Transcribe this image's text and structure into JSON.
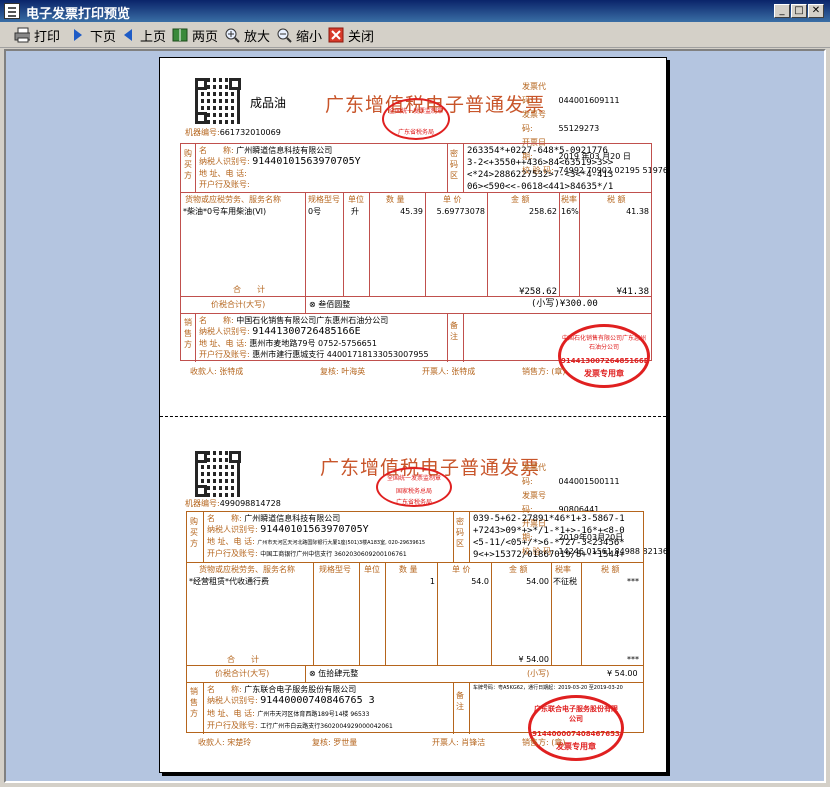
{
  "window": {
    "title": "电子发票打印预览"
  },
  "toolbar": [
    {
      "label": "打印",
      "icon": "printer-icon"
    },
    {
      "label": "下页",
      "icon": "next-page-icon"
    },
    {
      "label": "上页",
      "icon": "prev-page-icon"
    },
    {
      "label": "两页",
      "icon": "two-page-icon"
    },
    {
      "label": "放大",
      "icon": "zoom-in-icon"
    },
    {
      "label": "缩小",
      "icon": "zoom-out-icon"
    },
    {
      "label": "关闭",
      "icon": "close-icon"
    }
  ],
  "invoice1": {
    "product_tag": "成品油",
    "title": "广东增值税电子普通发票",
    "stamp_top": "全国统一发票监制章",
    "stamp_top_sub": "广东省税务局",
    "code_label": "发票代码:",
    "code": "044001609111",
    "number_label": "发票号码:",
    "number": "55129273",
    "date_label": "开票日期:",
    "date": "2019 年03 月20 日",
    "check_label": "校 验 码:",
    "check": "74992 70902 02195 51976",
    "machine_label": "机器编号:",
    "machine": "661732010069",
    "buyer_side": "购买方",
    "buyer_name_label": "名　　称:",
    "buyer_name": "广州瞬道信息科技有限公司",
    "buyer_tax_label": "纳税人识别号:",
    "buyer_tax": "91440101563970705Y",
    "buyer_addr_label": "地 址、电 话:",
    "buyer_bank_label": "开户行及账号:",
    "cipher_side": "密码区",
    "cipher": [
      "263354*+0227-648*5-0921776",
      "3-2<+3550++436>84<63519>3>>",
      "<*24>2886227532>7-<3<*4-413",
      "06><590<<-0618<441>84635*/1"
    ],
    "col_item": "货物或应税劳务、服务名称",
    "col_spec": "规格型号",
    "col_unit": "单位",
    "col_qty": "数 量",
    "col_price": "单 价",
    "col_amount": "金 额",
    "col_rate": "税率",
    "col_tax": "税 额",
    "item": "*柴油*0号车用柴油(VI)",
    "spec": "0号",
    "unit": "升",
    "qty": "45.39",
    "price": "5.69773078",
    "amount": "258.62",
    "rate": "16%",
    "tax": "41.38",
    "subtotal_label": "合　　计",
    "subtotal_amount": "¥258.62",
    "subtotal_tax": "¥41.38",
    "total_label": "价税合计(大写)",
    "total_words": "⊗ 叁佰圆整",
    "total_small": "(小写)¥300.00",
    "seller_side": "销售方",
    "seller_name_label": "名　　称:",
    "seller_name": "中国石化销售有限公司广东惠州石油分公司",
    "seller_tax_label": "纳税人识别号:",
    "seller_tax": "91441300726485166E",
    "seller_addr_label": "地 址、电 话:",
    "seller_addr": "惠州市麦地路79号 0752-5756651",
    "seller_bank_label": "开户行及账号:",
    "seller_bank": "惠州市建行惠城支行 44001718133053007955",
    "remark_side": "备注",
    "seller_stamp_top": "中国石化销售有限公司广东惠州石油分公司",
    "seller_stamp_id": "91441300726485166E",
    "seller_stamp_bottom": "发票专用章",
    "payee": "收款人: 张特成",
    "reviewer": "复核: 叶海英",
    "drawer": "开票人: 张特成",
    "seller_sign": "销售方: (章)"
  },
  "invoice2": {
    "title": "广东增值税电子普通发票",
    "stamp_top": "全国统一发票监制章",
    "stamp_top_sub": "国家税务总局",
    "stamp_top_sub2": "广东省税务局",
    "code_label": "发票代码:",
    "code": "044001500111",
    "number_label": "发票号码:",
    "number": "90806441",
    "date_label": "开票日期:",
    "date": "2019年03月20日",
    "check_label": "校 验 码:",
    "check": "14246 01561 84988 82136",
    "machine_label": "机器编号:",
    "machine": "499098814728",
    "buyer_side": "购买方",
    "buyer_name_label": "名　　称:",
    "buyer_name": "广州瞬道信息科技有限公司",
    "buyer_tax_label": "纳税人识别号:",
    "buyer_tax": "91440101563970705Y",
    "buyer_addr_label": "地 址、电 话:",
    "buyer_addr": "广州市天河区天河北路国际银行大厦1座(501)3楼A183室, 020-29639615",
    "buyer_bank_label": "开户行及账号:",
    "buyer_bank": "中国工商银行广州中信支行 3602030609200106761",
    "cipher_side": "密码区",
    "cipher": [
      "039-5+62-27891*46*1+3-5867-1",
      "+7243>09*+>*/1-*1+>-16*+<8-0",
      "<5-11/<05+/*>6-*727-3<23456*",
      "9<+>15372/01867019/8+-*1544+"
    ],
    "col_item": "货物或应税劳务、服务名称",
    "col_spec": "规格型号",
    "col_unit": "单位",
    "col_qty": "数 量",
    "col_price": "单 价",
    "col_amount": "金 额",
    "col_rate": "税率",
    "col_tax": "税 额",
    "item": "*经营租赁*代收通行费",
    "qty": "1",
    "price": "54.0",
    "amount": "54.00",
    "rate": "不征税",
    "tax": "***",
    "subtotal_label": "合　　计",
    "subtotal_amount": "¥ 54.00",
    "subtotal_tax": "***",
    "total_label": "价税合计(大写)",
    "total_words": "⊗ 伍拾肆元整",
    "total_small_label": "(小写)",
    "total_small": "¥ 54.00",
    "seller_side": "销售方",
    "seller_name_label": "名　　称:",
    "seller_name": "广东联合电子服务股份有限公司",
    "seller_tax_label": "纳税人识别号:",
    "seller_tax": "91440000740846765 3",
    "seller_addr_label": "地 址、电 话:",
    "seller_addr": "广州市天河区体育西路189号14楼 96533",
    "seller_bank_label": "开户行及账号:",
    "seller_bank": "工行广州市白云路支行3602004929000042061",
    "remark_side": "备注",
    "remark": "车牌号码：粤A5KG62，通行日期起：2019-03-20 至2019-03-20",
    "seller_stamp_top": "广东联合电子服务股份有限公司",
    "seller_stamp_id": "914400007408467653",
    "seller_stamp_bottom": "发票专用章",
    "payee": "收款人: 宋楚玲",
    "reviewer": "复核: 罗世量",
    "drawer": "开票人: 肖锋洁",
    "seller_sign": "销售方: (章)"
  }
}
